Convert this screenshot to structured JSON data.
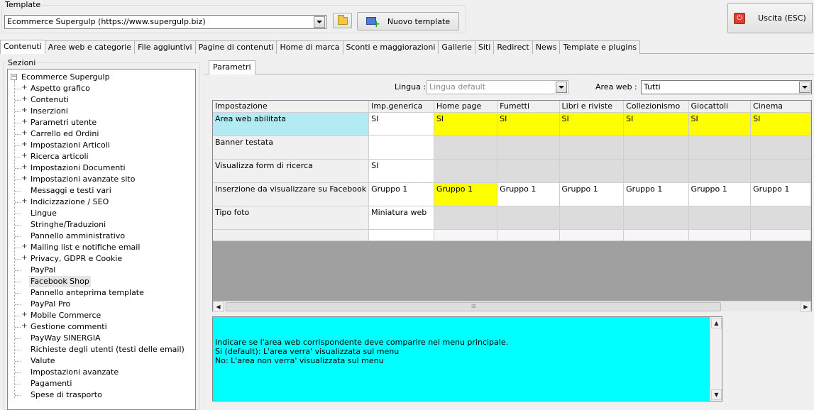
{
  "template_group": {
    "legend": "Template",
    "selected": "Ecommerce Supergulp (https://www.supergulp.biz)",
    "new_template": "Nuovo template"
  },
  "exit_button": "Uscita (ESC)",
  "tabs": [
    "Contenuti",
    "Aree web e categorie",
    "File aggiuntivi",
    "Pagine di contenuti",
    "Home di marca",
    "Sconti e maggiorazioni",
    "Gallerie",
    "Siti",
    "Redirect",
    "News",
    "Template e plugins"
  ],
  "sections": {
    "legend": "Sezioni",
    "root": "Ecommerce Supergulp",
    "items": [
      {
        "label": "Aspetto grafico",
        "expandable": true
      },
      {
        "label": "Contenuti",
        "expandable": true
      },
      {
        "label": "Inserzioni",
        "expandable": true
      },
      {
        "label": "Parametri utente",
        "expandable": true
      },
      {
        "label": "Carrello ed Ordini",
        "expandable": true
      },
      {
        "label": "Impostazioni Articoli",
        "expandable": true
      },
      {
        "label": "Ricerca articoli",
        "expandable": true
      },
      {
        "label": "Impostazioni Documenti",
        "expandable": true
      },
      {
        "label": "Impostazioni avanzate sito",
        "expandable": true
      },
      {
        "label": "Messaggi e testi vari",
        "expandable": false
      },
      {
        "label": "Indicizzazione / SEO",
        "expandable": true
      },
      {
        "label": "Lingue",
        "expandable": false
      },
      {
        "label": "Stringhe/Traduzioni",
        "expandable": false
      },
      {
        "label": "Pannello amministrativo",
        "expandable": false
      },
      {
        "label": "Mailing list e notifiche email",
        "expandable": true
      },
      {
        "label": "Privacy, GDPR e Cookie",
        "expandable": true
      },
      {
        "label": "PayPal",
        "expandable": false
      },
      {
        "label": "Facebook Shop",
        "expandable": false,
        "selected": true
      },
      {
        "label": "Pannello anteprima template",
        "expandable": false
      },
      {
        "label": "PayPal Pro",
        "expandable": false
      },
      {
        "label": "Mobile Commerce",
        "expandable": true
      },
      {
        "label": "Gestione commenti",
        "expandable": true
      },
      {
        "label": "PayWay SINERGIA",
        "expandable": false
      },
      {
        "label": "Richieste degli utenti (testi delle email)",
        "expandable": false
      },
      {
        "label": "Valute",
        "expandable": false
      },
      {
        "label": "Impostazioni avanzate",
        "expandable": false
      },
      {
        "label": "Pagamenti",
        "expandable": false
      },
      {
        "label": "Spese di trasporto",
        "expandable": false
      }
    ]
  },
  "params": {
    "tab": "Parametri",
    "lingua_label": "Lingua :",
    "lingua_value": "Lingua default",
    "area_label": "Area web :",
    "area_value": "Tutti"
  },
  "grid": {
    "columns": [
      "Impostazione",
      "Imp.generica",
      "Home page",
      "Fumetti",
      "Libri e riviste",
      "Collezionismo",
      "Giocattoli",
      "Cinema"
    ],
    "rows": [
      {
        "label": "Area web abilitata",
        "cells": [
          "SI",
          "SI",
          "SI",
          "SI",
          "SI",
          "SI",
          "SI"
        ]
      },
      {
        "label": "Banner testata",
        "cells": [
          "",
          "",
          "",
          "",
          "",
          "",
          ""
        ]
      },
      {
        "label": "Visualizza form di ricerca",
        "cells": [
          "SI",
          "",
          "",
          "",
          "",
          "",
          ""
        ]
      },
      {
        "label": "Inserzione da visualizzare su Facebook",
        "cells": [
          "Gruppo 1",
          "Gruppo 1",
          "Gruppo 1",
          "Gruppo 1",
          "Gruppo 1",
          "Gruppo 1",
          "Gruppo 1"
        ]
      },
      {
        "label": "Tipo foto",
        "cells": [
          "Miniatura web",
          "",
          "",
          "",
          "",
          "",
          ""
        ]
      }
    ],
    "highlight_color": "#ffff00",
    "selected_row_color": "#b2ecf2"
  },
  "description": {
    "lines": [
      "Indicare se l'area web corrispondente deve comparire nel menu principale.",
      "Si (default): L'area verra' visualizzata sul menu",
      "No: L'area non verra' visualizzata sul menu"
    ],
    "background": "#00ffff"
  }
}
